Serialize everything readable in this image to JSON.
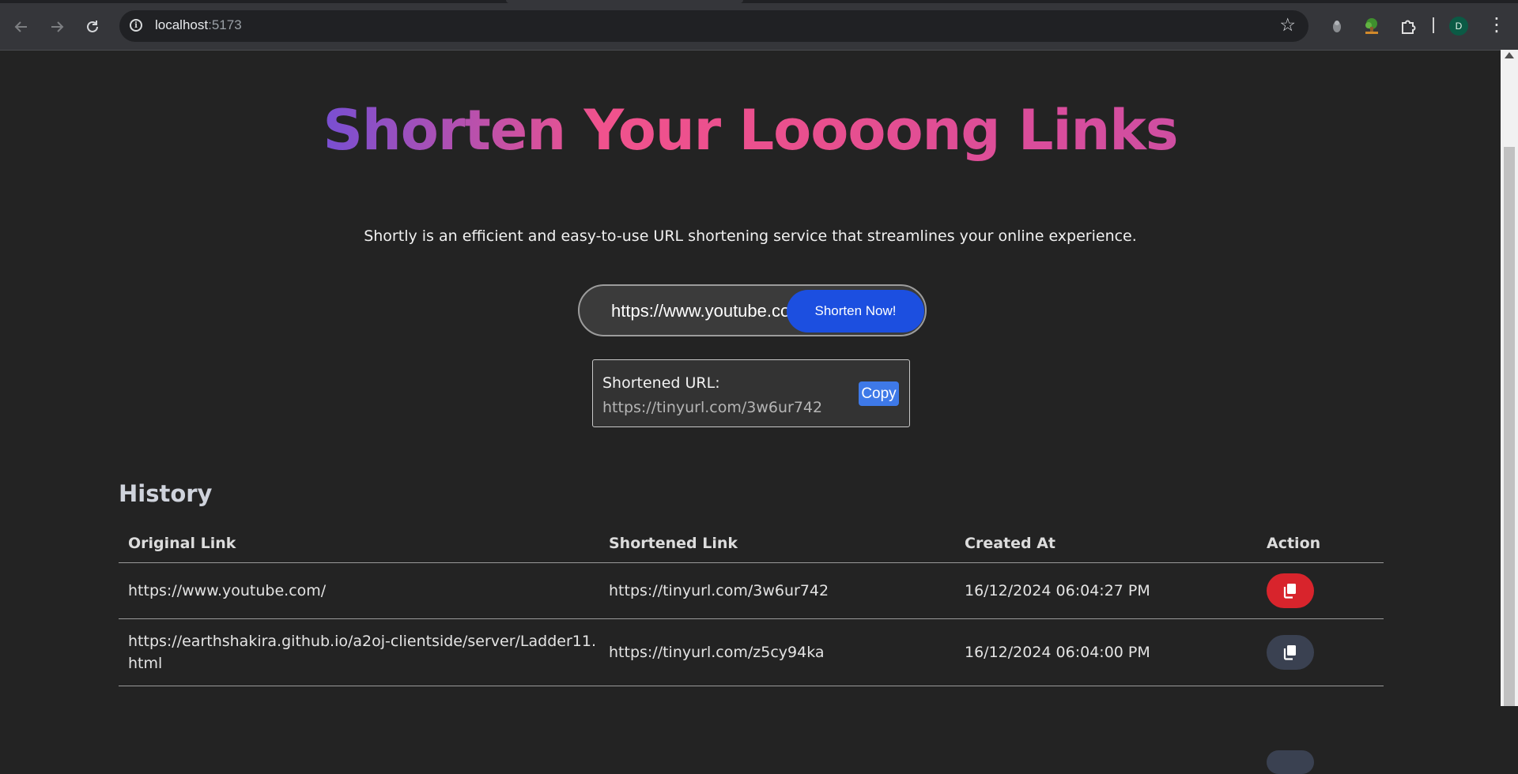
{
  "browser": {
    "url_host": "localhost",
    "url_port": ":5173",
    "profile_initial": "D",
    "icons": {
      "back": "arrow-left-icon",
      "forward": "arrow-right-icon",
      "reload": "reload-icon",
      "site_info": "info-icon",
      "bookmark": "star-icon",
      "extension_1": "puzzle-icon",
      "menu": "kebab-menu-icon"
    }
  },
  "hero": {
    "title": "Shorten Your Loooong Links",
    "subtitle": "Shortly is an efficient and easy-to-use URL shortening service that streamlines your online experience."
  },
  "form": {
    "input_value": "https://www.youtube.com/",
    "submit_label": "Shorten Now!"
  },
  "result": {
    "label": "Shortened URL:",
    "url": "https://tinyurl.com/3w6ur742",
    "copy_label": "Copy"
  },
  "history": {
    "title": "History",
    "columns": [
      "Original Link",
      "Shortened Link",
      "Created At",
      "Action"
    ],
    "rows": [
      {
        "original": "https://www.youtube.com/",
        "shortened": "https://tinyurl.com/3w6ur742",
        "created": "16/12/2024 06:04:27 PM",
        "action_icon": "copy-icon",
        "action_color": "#d8242c"
      },
      {
        "original": "https://earthshakira.github.io/a2oj-clientside/server/Ladder11.html",
        "shortened": "https://tinyurl.com/z5cy94ka",
        "created": "16/12/2024 06:04:00 PM",
        "action_icon": "copy-icon",
        "action_color": "#3a4151"
      }
    ]
  },
  "colors": {
    "background": "#232323",
    "primary_button": "#1c4fe0",
    "copy_button": "#3e79e8",
    "active_action": "#d8242c",
    "inactive_action": "#3a4151"
  }
}
